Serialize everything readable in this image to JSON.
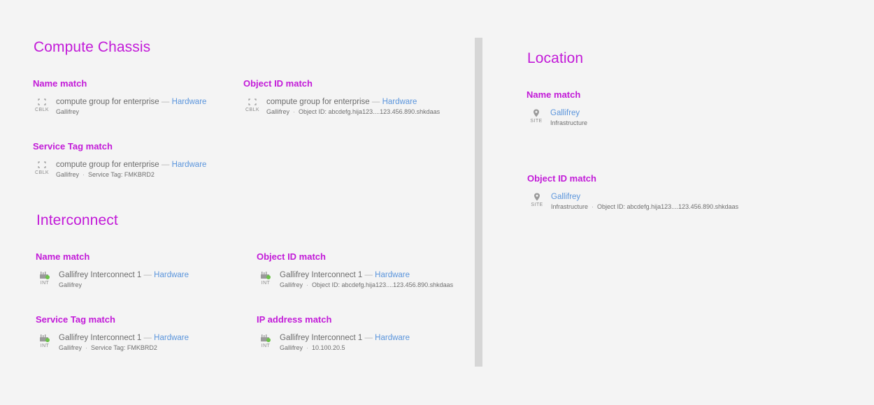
{
  "compute_chassis": {
    "title": "Compute Chassis",
    "name_match": {
      "label": "Name match",
      "type_code": "CBLK",
      "name": "compute group for enterprise",
      "dash": "—",
      "category": "Hardware",
      "meta1": "Gallifrey"
    },
    "object_id_match": {
      "label": "Object ID match",
      "type_code": "CBLK",
      "name": "compute group for enterprise",
      "dash": "—",
      "category": "Hardware",
      "meta1": "Gallifrey",
      "sep": "·",
      "meta2": "Object ID: abcdefg.hija123....123.456.890.shkdaas"
    },
    "service_tag_match": {
      "label": "Service Tag match",
      "type_code": "CBLK",
      "name": "compute group for enterprise",
      "dash": "—",
      "category": "Hardware",
      "meta1": "Gallifrey",
      "sep": "·",
      "meta2": "Service Tag: FMKBRD2"
    }
  },
  "interconnect": {
    "title": "Interconnect",
    "name_match": {
      "label": "Name match",
      "type_code": "INT",
      "name": "Gallifrey Interconnect 1",
      "dash": "—",
      "category": "Hardware",
      "meta1": "Gallifrey"
    },
    "object_id_match": {
      "label": "Object ID match",
      "type_code": "INT",
      "name": "Gallifrey Interconnect 1",
      "dash": "—",
      "category": "Hardware",
      "meta1": "Gallifrey",
      "sep": "·",
      "meta2": "Object ID: abcdefg.hija123....123.456.890.shkdaas"
    },
    "service_tag_match": {
      "label": "Service Tag match",
      "type_code": "INT",
      "name": "Gallifrey Interconnect 1",
      "dash": "—",
      "category": "Hardware",
      "meta1": "Gallifrey",
      "sep": "·",
      "meta2": "Service Tag: FMKBRD2"
    },
    "ip_address_match": {
      "label": "IP address match",
      "type_code": "INT",
      "name": "Gallifrey Interconnect 1",
      "dash": "—",
      "category": "Hardware",
      "meta1": "Gallifrey",
      "sep": "·",
      "meta2": "10.100.20.5"
    }
  },
  "location": {
    "title": "Location",
    "name_match": {
      "label": "Name match",
      "type_code": "SITE",
      "name": "Gallifrey",
      "meta1": "Infrastructure"
    },
    "object_id_match": {
      "label": "Object ID match",
      "type_code": "SITE",
      "name": "Gallifrey",
      "meta1": "Infrastructure",
      "sep": "·",
      "meta2": "Object ID: abcdefg.hija123....123.456.890.shkdaas"
    }
  },
  "icons": {
    "chassis": "chassis-icon",
    "interconnect": "interconnect-icon",
    "status_ok": "status-ok-dot",
    "location": "map-pin-icon"
  },
  "colors": {
    "heading": "#c21ad8",
    "link": "#5b95dc",
    "status_ok": "#6cc24a",
    "background": "#f4f4f4",
    "divider": "#d6d6d6"
  }
}
